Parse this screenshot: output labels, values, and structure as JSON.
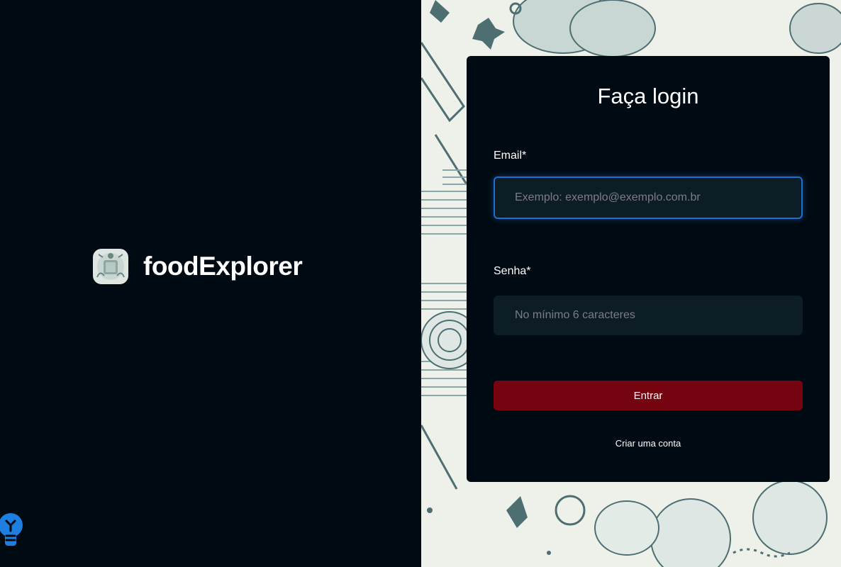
{
  "brand": {
    "name": "foodExplorer"
  },
  "login": {
    "title": "Faça login",
    "email_label": "Email*",
    "email_placeholder": "Exemplo: exemplo@exemplo.com.br",
    "email_value": "",
    "password_label": "Senha*",
    "password_placeholder": "No mínimo 6 caracteres",
    "password_value": "",
    "submit_label": "Entrar",
    "create_account_label": "Criar uma conta"
  },
  "icons": {
    "logo": "chef-logo-icon",
    "hint": "lightbulb-icon"
  },
  "colors": {
    "background": "#000a12",
    "input_bg": "#0d1d25",
    "button": "#750310",
    "focus": "#1e6fd0"
  }
}
